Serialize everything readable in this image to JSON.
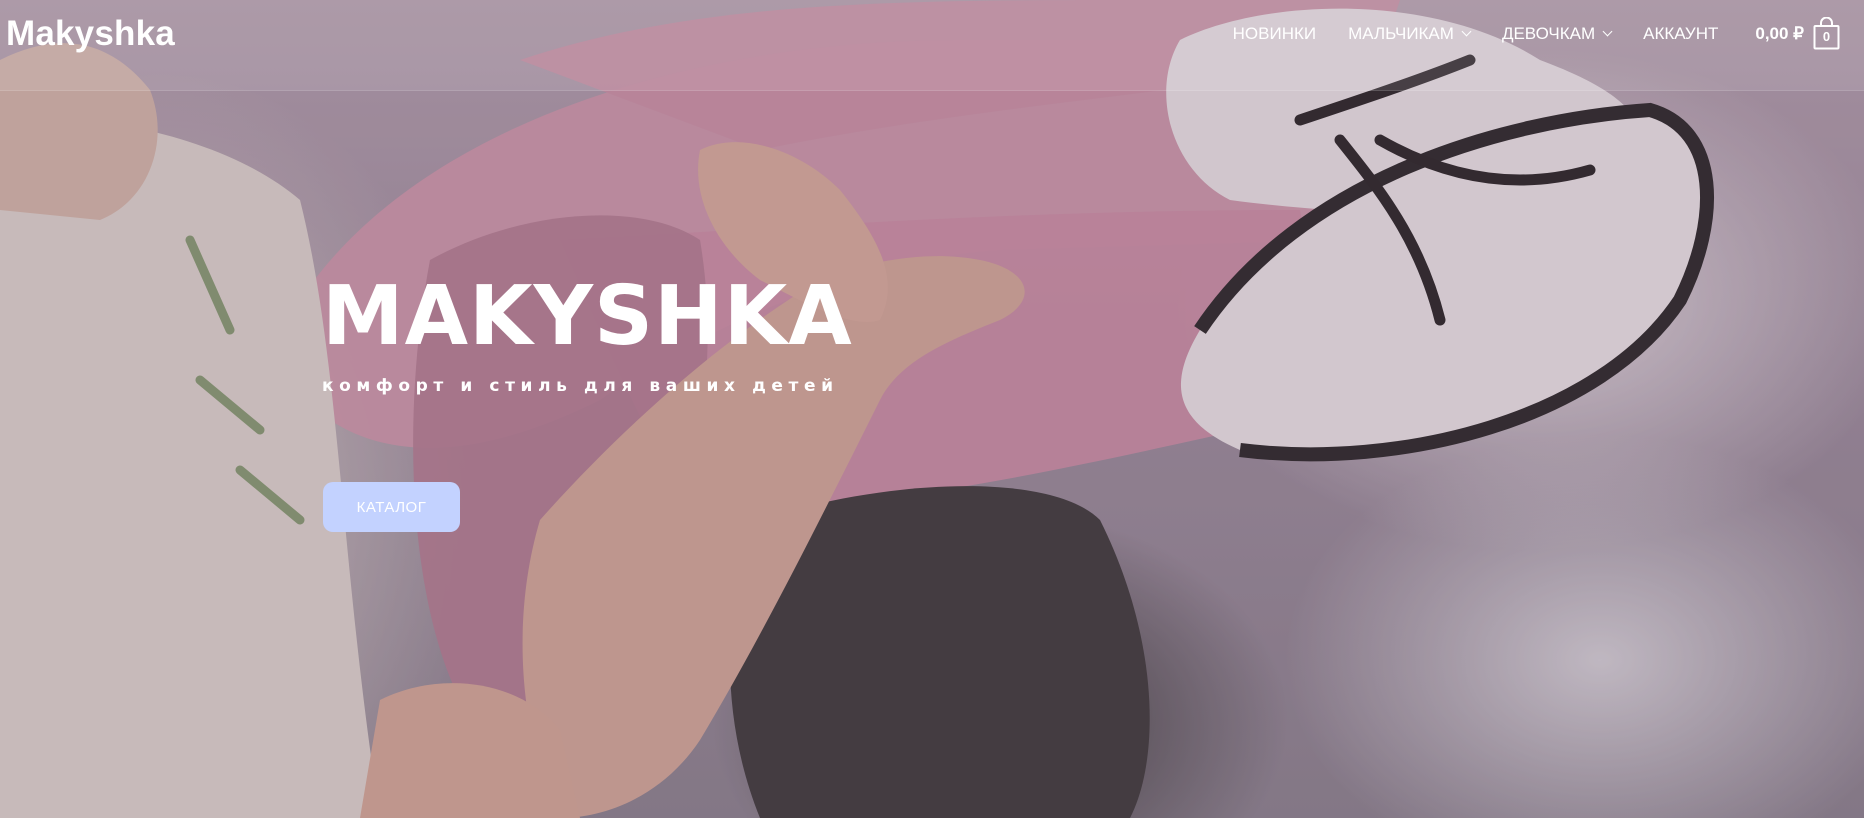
{
  "header": {
    "logo": "Makyshka",
    "nav": [
      {
        "label": "НОВИНКИ",
        "has_dropdown": false
      },
      {
        "label": "МАЛЬЧИКАМ",
        "has_dropdown": true
      },
      {
        "label": "ДЕВОЧКАМ",
        "has_dropdown": true
      },
      {
        "label": "АККАУНТ",
        "has_dropdown": false
      }
    ],
    "cart": {
      "total": "0,00 ₽",
      "count": "0",
      "icon": "shopping-bag-icon"
    }
  },
  "hero": {
    "title": "MAKYSHKA",
    "subtitle": "комфорт и стиль для ваших детей",
    "button_label": "КАТАЛОГ",
    "background_image": "child-in-pink-tights-photo"
  },
  "colors": {
    "button_bg": "#c3d2ff",
    "text": "#ffffff"
  }
}
